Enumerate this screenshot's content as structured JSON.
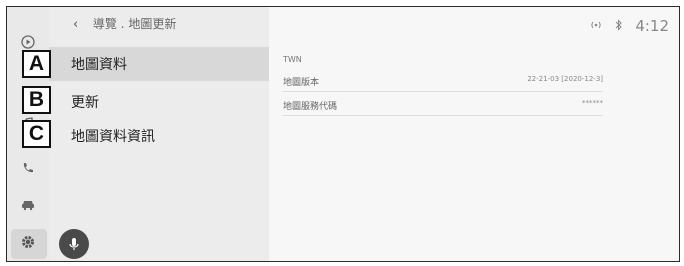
{
  "breadcrumb": {
    "back_icon": "chevron-left-icon",
    "parent": "導覽",
    "separator": ".",
    "current": "地圖更新"
  },
  "menu": {
    "items": [
      {
        "label": "地圖資料",
        "callout": "A",
        "selected": true
      },
      {
        "label": "更新",
        "callout": "B",
        "selected": false
      },
      {
        "label": "地圖資料資訊",
        "callout": "C",
        "selected": false
      }
    ]
  },
  "rail": {
    "icons": [
      "play-circle-icon",
      "music-note-icon",
      "phone-icon",
      "car-icon",
      "gear-icon"
    ],
    "active": "gear-icon"
  },
  "mic": {
    "icon": "microphone-icon"
  },
  "status": {
    "signal_icon": "wireless-signal-icon",
    "bluetooth_icon": "bluetooth-icon",
    "time": "4:12"
  },
  "detail": {
    "region": "TWN",
    "rows": [
      {
        "label": "地圖版本",
        "value": "22-21-03 [2020-12-3]"
      },
      {
        "label": "地圖服務代碼",
        "value": "******"
      }
    ]
  }
}
